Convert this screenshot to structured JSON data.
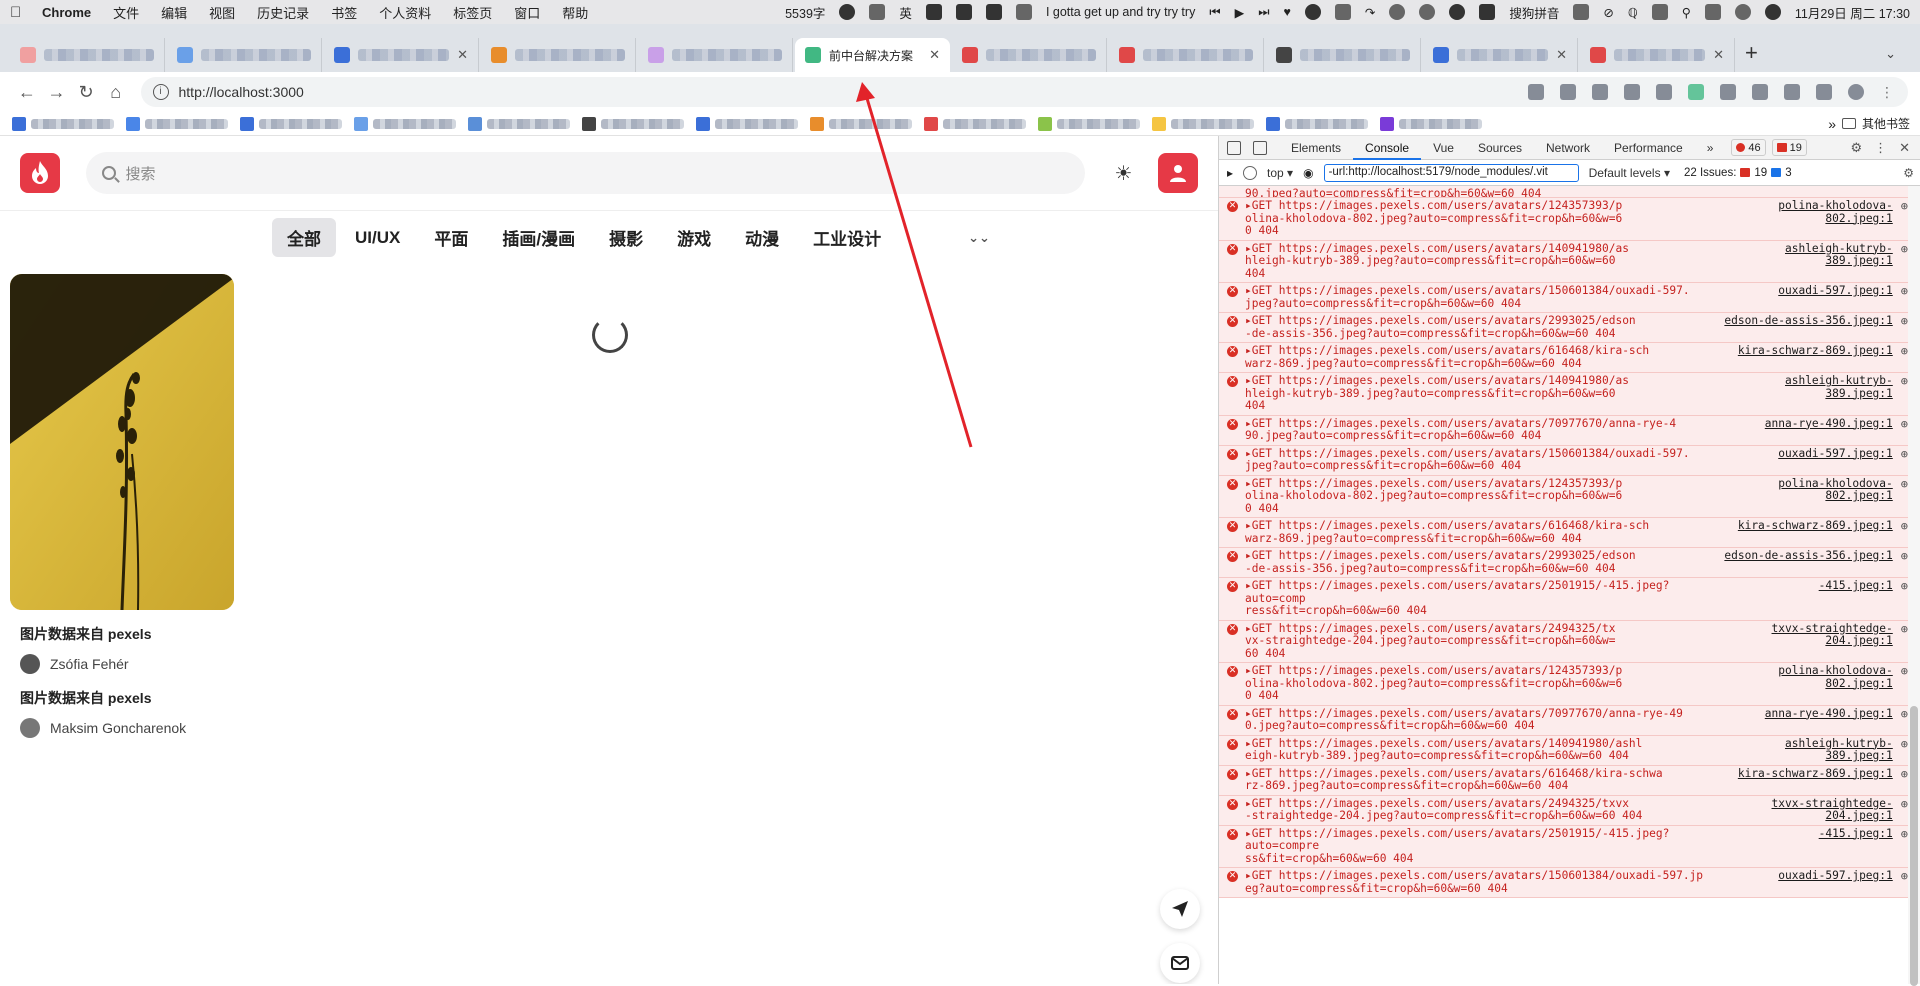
{
  "menubar": {
    "app": "Chrome",
    "items": [
      "文件",
      "编辑",
      "视图",
      "历史记录",
      "书签",
      "个人资料",
      "标签页",
      "窗口",
      "帮助"
    ],
    "word_count": "5539字",
    "ime_label": "英",
    "song": "I gotta get up and try try try",
    "input_method": "搜狗拼音",
    "datetime": "11月29日 周二  17:30"
  },
  "browser": {
    "active_tab_title": "前中台解决方案",
    "url": "http://localhost:3000",
    "other_bookmarks": "其他书签"
  },
  "site": {
    "search_placeholder": "搜索",
    "categories": [
      "全部",
      "UI/UX",
      "平面",
      "插画/漫画",
      "摄影",
      "游戏",
      "动漫",
      "工业设计"
    ],
    "active_category": "全部",
    "cards": [
      {
        "title": "图片数据来自 pexels",
        "author": "Zsófia Fehér"
      },
      {
        "title": "图片数据来自 pexels",
        "author": "Maksim Goncharenok"
      }
    ]
  },
  "devtools": {
    "tabs": [
      "Elements",
      "Console",
      "Vue",
      "Sources",
      "Network",
      "Performance"
    ],
    "active_tab": "Console",
    "error_count": "46",
    "warning_count": "19",
    "context": "top",
    "filter": "-url:http://localhost:5179/node_modules/.vit",
    "levels": "Default levels",
    "issues_label": "22 Issues:",
    "issues_errors": "19",
    "issues_info": "3",
    "first_partial": "90.jpeg?auto=compress&fit=crop&h=60&w=60 404",
    "logs": [
      {
        "l1": "GET https://images.pexels.com/users/avatars/124357393/p",
        "l2": "olina-kholodova-802.jpeg?auto=compress&fit=crop&h=60&w=6",
        "l3": "0 404",
        "src": "polina-kholodova-802.jpeg:1"
      },
      {
        "l1": "GET https://images.pexels.com/users/avatars/140941980/as",
        "l2": "hleigh-kutryb-389.jpeg?auto=compress&fit=crop&h=60&w=60",
        "l3": "404",
        "src": "ashleigh-kutryb-389.jpeg:1"
      },
      {
        "l1": "GET https://images.pexels.com/users/avatars/150601384/ouxadi-597.",
        "l2": "jpeg?auto=compress&fit=crop&h=60&w=60 404",
        "l3": "",
        "src": "ouxadi-597.jpeg:1"
      },
      {
        "l1": "GET https://images.pexels.com/users/avatars/2993025/edson",
        "l2": "-de-assis-356.jpeg?auto=compress&fit=crop&h=60&w=60 404",
        "l3": "",
        "src": "edson-de-assis-356.jpeg:1"
      },
      {
        "l1": "GET https://images.pexels.com/users/avatars/616468/kira-sch",
        "l2": "warz-869.jpeg?auto=compress&fit=crop&h=60&w=60 404",
        "l3": "",
        "src": "kira-schwarz-869.jpeg:1"
      },
      {
        "l1": "GET https://images.pexels.com/users/avatars/140941980/as",
        "l2": "hleigh-kutryb-389.jpeg?auto=compress&fit=crop&h=60&w=60",
        "l3": "404",
        "src": "ashleigh-kutryb-389.jpeg:1"
      },
      {
        "l1": "GET https://images.pexels.com/users/avatars/70977670/anna-rye-4",
        "l2": "90.jpeg?auto=compress&fit=crop&h=60&w=60 404",
        "l3": "",
        "src": "anna-rye-490.jpeg:1"
      },
      {
        "l1": "GET https://images.pexels.com/users/avatars/150601384/ouxadi-597.",
        "l2": "jpeg?auto=compress&fit=crop&h=60&w=60 404",
        "l3": "",
        "src": "ouxadi-597.jpeg:1"
      },
      {
        "l1": "GET https://images.pexels.com/users/avatars/124357393/p",
        "l2": "olina-kholodova-802.jpeg?auto=compress&fit=crop&h=60&w=6",
        "l3": "0 404",
        "src": "polina-kholodova-802.jpeg:1"
      },
      {
        "l1": "GET https://images.pexels.com/users/avatars/616468/kira-sch",
        "l2": "warz-869.jpeg?auto=compress&fit=crop&h=60&w=60 404",
        "l3": "",
        "src": "kira-schwarz-869.jpeg:1"
      },
      {
        "l1": "GET https://images.pexels.com/users/avatars/2993025/edson",
        "l2": "-de-assis-356.jpeg?auto=compress&fit=crop&h=60&w=60 404",
        "l3": "",
        "src": "edson-de-assis-356.jpeg:1"
      },
      {
        "l1": "GET https://images.pexels.com/users/avatars/2501915/-415.jpeg?auto=comp",
        "l2": "ress&fit=crop&h=60&w=60 404",
        "l3": "",
        "src": "-415.jpeg:1"
      },
      {
        "l1": "GET https://images.pexels.com/users/avatars/2494325/tx",
        "l2": "vx-straightedge-204.jpeg?auto=compress&fit=crop&h=60&w=",
        "l3": "60 404",
        "src": "txvx-straightedge-204.jpeg:1"
      },
      {
        "l1": "GET https://images.pexels.com/users/avatars/124357393/p",
        "l2": "olina-kholodova-802.jpeg?auto=compress&fit=crop&h=60&w=6",
        "l3": "0 404",
        "src": "polina-kholodova-802.jpeg:1"
      },
      {
        "l1": "GET https://images.pexels.com/users/avatars/70977670/anna-rye-49",
        "l2": "0.jpeg?auto=compress&fit=crop&h=60&w=60 404",
        "l3": "",
        "src": "anna-rye-490.jpeg:1"
      },
      {
        "l1": "GET https://images.pexels.com/users/avatars/140941980/ashl",
        "l2": "eigh-kutryb-389.jpeg?auto=compress&fit=crop&h=60&w=60 404",
        "l3": "",
        "src": "ashleigh-kutryb-389.jpeg:1"
      },
      {
        "l1": "GET https://images.pexels.com/users/avatars/616468/kira-schwa",
        "l2": "rz-869.jpeg?auto=compress&fit=crop&h=60&w=60 404",
        "l3": "",
        "src": "kira-schwarz-869.jpeg:1"
      },
      {
        "l1": "GET https://images.pexels.com/users/avatars/2494325/txvx",
        "l2": "-straightedge-204.jpeg?auto=compress&fit=crop&h=60&w=60 404",
        "l3": "",
        "src": "txvx-straightedge-204.jpeg:1"
      },
      {
        "l1": "GET https://images.pexels.com/users/avatars/2501915/-415.jpeg?auto=compre",
        "l2": "ss&fit=crop&h=60&w=60 404",
        "l3": "",
        "src": "-415.jpeg:1"
      },
      {
        "l1": "GET https://images.pexels.com/users/avatars/150601384/ouxadi-597.jp",
        "l2": "eg?auto=compress&fit=crop&h=60&w=60 404",
        "l3": "",
        "src": "ouxadi-597.jpeg:1"
      }
    ]
  },
  "colors": {
    "brand": "#e63946",
    "annotation_arrow": "#e2232a",
    "error_red": "#d93025"
  }
}
